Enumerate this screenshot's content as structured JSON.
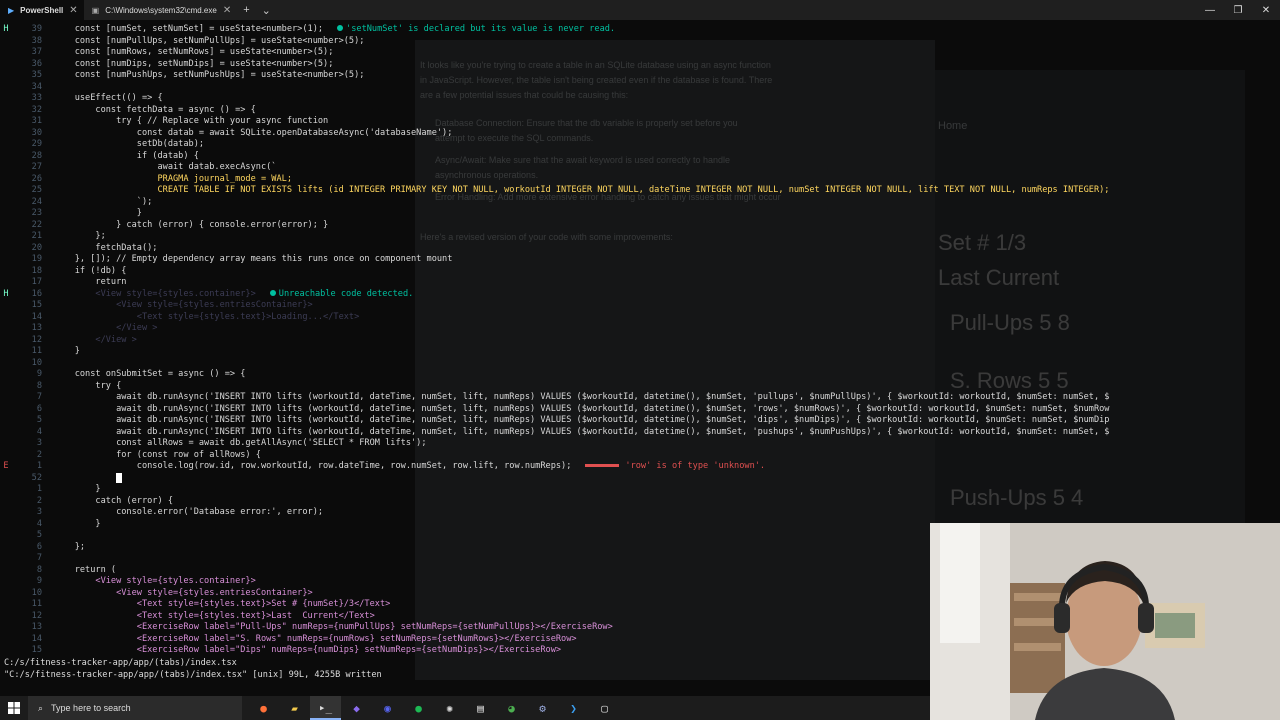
{
  "tabs": [
    {
      "label": "PowerShell",
      "active": true
    },
    {
      "label": "C:\\Windows\\system32\\cmd.exe",
      "active": false
    }
  ],
  "tab_extra": {
    "new_tab": "+",
    "dropdown": "⌄"
  },
  "window_controls": {
    "minimize": "—",
    "maximize": "❐",
    "close": "✕"
  },
  "ghost": {
    "lines": [
      "It looks like you're trying to create a table in an SQLite database using an async function",
      "in JavaScript. However, the table isn't being created even if the database is found. There",
      "are a few potential issues that could be causing this:",
      "Database Connection: Ensure that the db variable is properly set before you",
      "attempt to execute the SQL commands.",
      "Async/Await: Make sure that the await keyword is used correctly to handle",
      "asynchronous operations.",
      "Error Handling: Add more extensive error handling to catch any issues that might occur",
      "Here's a revised version of your code with some improvements:"
    ],
    "home": "Home",
    "set": "Set # 1/3",
    "last_current": "Last   Current",
    "pullups": "Pull-Ups   5    8",
    "rows": "S. Rows    5    5",
    "pushups": "Push-Ups   5    4"
  },
  "code": [
    {
      "n": "39",
      "sign": "H",
      "t": "    const [numSet, setNumSet] = useState<number>(1);",
      "diag": "'setNumSet' is declared but its value is never read.",
      "dtype": "h"
    },
    {
      "n": "38",
      "t": "    const [numPullUps, setNumPullUps] = useState<number>(5);"
    },
    {
      "n": "37",
      "t": "    const [numRows, setNumRows] = useState<number>(5);"
    },
    {
      "n": "36",
      "t": "    const [numDips, setNumDips] = useState<number>(5);"
    },
    {
      "n": "35",
      "t": "    const [numPushUps, setNumPushUps] = useState<number>(5);"
    },
    {
      "n": "34",
      "t": ""
    },
    {
      "n": "33",
      "t": "    useEffect(() => {"
    },
    {
      "n": "32",
      "t": "        const fetchData = async () => {"
    },
    {
      "n": "31",
      "t": "            try { // Replace with your async function"
    },
    {
      "n": "30",
      "t": "                const datab = await SQLite.openDatabaseAsync('databaseName');"
    },
    {
      "n": "29",
      "t": "                setDb(datab);"
    },
    {
      "n": "28",
      "t": "                if (datab) {"
    },
    {
      "n": "27",
      "t": "                    await datab.execAsync(`"
    },
    {
      "n": "26",
      "t": "                    PRAGMA journal_mode = WAL;"
    },
    {
      "n": "25",
      "t": "                    CREATE TABLE IF NOT EXISTS lifts (id INTEGER PRIMARY KEY NOT NULL, workoutId INTEGER NOT NULL, dateTime INTEGER NOT NULL, numSet INTEGER NOT NULL, lift TEXT NOT NULL, numReps INTEGER);"
    },
    {
      "n": "24",
      "t": "                `);"
    },
    {
      "n": "23",
      "t": "                }"
    },
    {
      "n": "22",
      "t": "            } catch (error) { console.error(error); }"
    },
    {
      "n": "21",
      "t": "        };"
    },
    {
      "n": "20",
      "t": "        fetchData();"
    },
    {
      "n": "19",
      "t": "    }, []); // Empty dependency array means this runs once on component mount"
    },
    {
      "n": "18",
      "t": "    if (!db) {"
    },
    {
      "n": "17",
      "t": "        return"
    },
    {
      "n": "16",
      "sign": "H",
      "t": "        <View style={styles.container}>",
      "diag": "Unreachable code detected.",
      "dtype": "h",
      "dim": true
    },
    {
      "n": "15",
      "t": "            <View style={styles.entriesContainer}>",
      "dim": true
    },
    {
      "n": "14",
      "t": "                <Text style={styles.text}>Loading...</Text>",
      "dim": true
    },
    {
      "n": "13",
      "t": "            </View >",
      "dim": true
    },
    {
      "n": "12",
      "t": "        </View >",
      "dim": true
    },
    {
      "n": "11",
      "t": "    }"
    },
    {
      "n": "10",
      "t": ""
    },
    {
      "n": "9",
      "t": "    const onSubmitSet = async () => {"
    },
    {
      "n": "8",
      "t": "        try {"
    },
    {
      "n": "7",
      "t": "            await db.runAsync('INSERT INTO lifts (workoutId, dateTime, numSet, lift, numReps) VALUES ($workoutId, datetime(), $numSet, 'pullups', $numPullUps)', { $workoutId: workoutId, $numSet: numSet, $"
    },
    {
      "n": "6",
      "t": "            await db.runAsync('INSERT INTO lifts (workoutId, dateTime, numSet, lift, numReps) VALUES ($workoutId, datetime(), $numSet, 'rows', $numRows)', { $workoutId: workoutId, $numSet: numSet, $numRow"
    },
    {
      "n": "5",
      "t": "            await db.runAsync('INSERT INTO lifts (workoutId, dateTime, numSet, lift, numReps) VALUES ($workoutId, datetime(), $numSet, 'dips', $numDips)', { $workoutId: workoutId, $numSet: numSet, $numDip"
    },
    {
      "n": "4",
      "t": "            await db.runAsync('INSERT INTO lifts (workoutId, dateTime, numSet, lift, numReps) VALUES ($workoutId, datetime(), $numSet, 'pushups', $numPushUps)', { $workoutId: workoutId, $numSet: numSet, $"
    },
    {
      "n": "3",
      "t": "            const allRows = await db.getAllAsync('SELECT * FROM lifts');"
    },
    {
      "n": "2",
      "t": "            for (const row of allRows) {"
    },
    {
      "n": "1",
      "sign": "E",
      "t": "                console.log(row.id, row.workoutId, row.dateTime, row.numSet, row.lift, row.numReps);",
      "diag": "'row' is of type 'unknown'.",
      "dtype": "e"
    },
    {
      "n": "52",
      "t": "            ",
      "cursor": true
    },
    {
      "n": "1",
      "t": "        }"
    },
    {
      "n": "2",
      "t": "        catch (error) {"
    },
    {
      "n": "3",
      "t": "            console.error('Database error:', error);"
    },
    {
      "n": "4",
      "t": "        }"
    },
    {
      "n": "5",
      "t": ""
    },
    {
      "n": "6",
      "t": "    };"
    },
    {
      "n": "7",
      "t": ""
    },
    {
      "n": "8",
      "t": "    return ("
    },
    {
      "n": "9",
      "t": "        <View style={styles.container}>"
    },
    {
      "n": "10",
      "t": "            <View style={styles.entriesContainer}>"
    },
    {
      "n": "11",
      "t": "                <Text style={styles.text}>Set # {numSet}/3</Text>"
    },
    {
      "n": "12",
      "t": "                <Text style={styles.text}>Last  Current</Text>"
    },
    {
      "n": "13",
      "t": "                <ExerciseRow label=\"Pull-Ups\" numReps={numPullUps} setNumReps={setNumPullUps}></ExerciseRow>"
    },
    {
      "n": "14",
      "t": "                <ExerciseRow label=\"S. Rows\" numReps={numRows} setNumReps={setNumRows}></ExerciseRow>"
    },
    {
      "n": "15",
      "t": "                <ExerciseRow label=\"Dips\" numReps={numDips} setNumReps={setNumDips}></ExerciseRow>"
    }
  ],
  "status": {
    "path": "C:/s/fitness-tracker-app/app/(tabs)/index.tsx",
    "written": "\"C:/s/fitness-tracker-app/app/(tabs)/index.tsx\" [unix] 99L, 4255B written"
  },
  "taskbar": {
    "search_placeholder": "Type here to search",
    "icons": [
      "firefox-icon",
      "file-explorer-icon",
      "terminal-icon",
      "obsidian-icon",
      "discord-icon",
      "spotify-icon",
      "chatgpt-icon",
      "notes-icon",
      "chrome-icon",
      "steam-icon",
      "vscode-icon",
      "app-icon"
    ]
  }
}
